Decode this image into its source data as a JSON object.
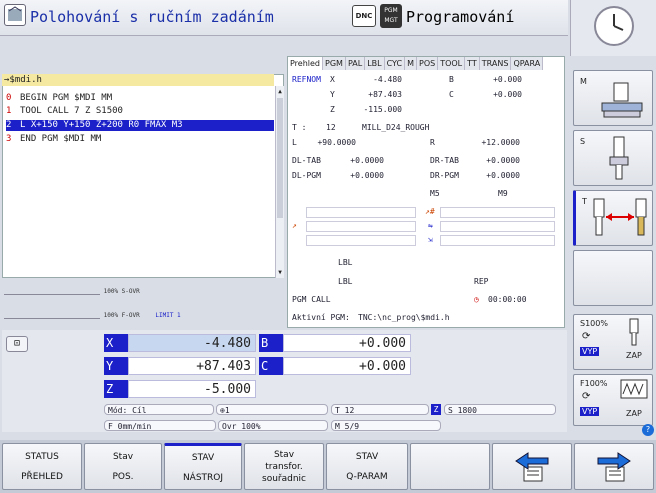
{
  "header": {
    "left_mode": "Polohování s ručním zadáním",
    "right_mode": "Programování",
    "dnc_label": "DNC",
    "pgm_mgt_label": "PGM MGT"
  },
  "program": {
    "file": "→$mdi.h",
    "lines": [
      {
        "n": "0",
        "text": "BEGIN PGM $MDI MM"
      },
      {
        "n": "1",
        "text": "TOOL CALL 7 Z S1500"
      },
      {
        "n": "2",
        "text": "L  X+150  Y+150  Z+200 R0 FMAX M3"
      },
      {
        "n": "3",
        "text": "END PGM $MDI MM"
      }
    ]
  },
  "overrides": {
    "s_ovr": "100% S-OVR",
    "f_ovr": "100% F-OVR",
    "limit": "LIMIT 1"
  },
  "status": {
    "tabs": [
      "Prehled",
      "PGM",
      "PAL",
      "LBL",
      "CYC",
      "M",
      "POS",
      "TOOL",
      "TT",
      "TRANS",
      "QPARA"
    ],
    "refnom": "REFNOM",
    "x_lbl": "X",
    "x_val": "-4.480",
    "y_lbl": "Y",
    "y_val": "+87.403",
    "z_lbl": "Z",
    "z_val": "-115.000",
    "b_lbl": "B",
    "b_val": "+0.000",
    "c_lbl": "C",
    "c_val": "+0.000",
    "t_lbl": "T :",
    "t_num": "12",
    "t_name": "MILL_D24_ROUGH",
    "l_lbl": "L",
    "l_val": "+90.0000",
    "r_lbl": "R",
    "r_val": "+12.0000",
    "dltab_lbl": "DL-TAB",
    "dltab_val": "+0.0000",
    "drtab_lbl": "DR-TAB",
    "drtab_val": "+0.0000",
    "dlpgm_lbl": "DL-PGM",
    "dlpgm_val": "+0.0000",
    "drpgm_lbl": "DR-PGM",
    "drpgm_val": "+0.0000",
    "m5": "M5",
    "m9": "M9",
    "lbl1": "LBL",
    "lbl2": "LBL",
    "rep": "REP",
    "pgm_call": "PGM CALL",
    "time": "00:00:00",
    "active_pgm_lbl": "Aktivní PGM:",
    "active_pgm_val": "TNC:\\nc_prog\\$mdi.h"
  },
  "axes": {
    "x_lbl": "X",
    "x_val": "-4.480",
    "y_lbl": "Y",
    "y_val": "+87.403",
    "z_lbl": "Z",
    "z_val": "-5.000",
    "b_lbl": "B",
    "b_val": "+0.000",
    "c_lbl": "C",
    "c_val": "+0.000"
  },
  "info": {
    "mode": "Mód: Cíl",
    "preset": "1",
    "tool": "T 12",
    "spindle_axis": "Z",
    "speed": "S 1800",
    "feed": "F 0mm/min",
    "ovr": "Ovr 100%",
    "mfunc": "M 5/9"
  },
  "softkeys": [
    {
      "name": "status-prehled",
      "line1": "STATUS",
      "line2": "PŘEHLED"
    },
    {
      "name": "stav-pos",
      "line1": "Stav",
      "line2": "POS."
    },
    {
      "name": "stav-nastroj",
      "line1": "STAV",
      "line2": "NÁSTROJ"
    },
    {
      "name": "stav-transfor",
      "line1": "Stav",
      "line2": "transfor.",
      "line3": "souřadnic"
    },
    {
      "name": "stav-qparam",
      "line1": "STAV",
      "line2": "Q-PARAM"
    }
  ],
  "vertical_softkeys": {
    "m_label": "M",
    "s_label": "S",
    "t_label": "T",
    "s100_label": "S100%",
    "f100_label": "F100%",
    "vyp": "VYP",
    "zap": "ZAP",
    "help": "?"
  },
  "colors": {
    "accent": "#1b20c8",
    "program_line_number": "#cc0000",
    "file_header": "#f5e8a0"
  }
}
